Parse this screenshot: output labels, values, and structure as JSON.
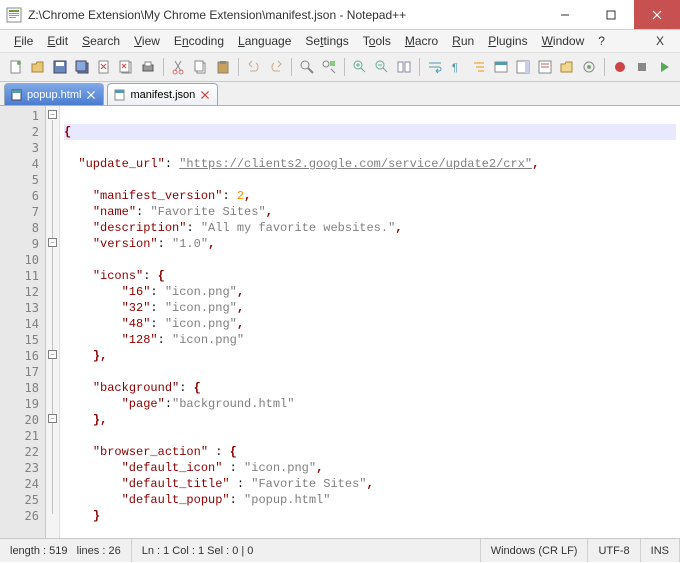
{
  "window": {
    "title": "Z:\\Chrome Extension\\My Chrome Extension\\manifest.json - Notepad++"
  },
  "menus": {
    "file": "File",
    "edit": "Edit",
    "search": "Search",
    "view": "View",
    "encoding": "Encoding",
    "language": "Language",
    "settings": "Settings",
    "tools": "Tools",
    "macro": "Macro",
    "run": "Run",
    "plugins": "Plugins",
    "window": "Window",
    "help": "?",
    "x": "X"
  },
  "tabs": {
    "t0": "popup.html",
    "t1": "manifest.json"
  },
  "lines": {
    "l1": "1",
    "l2": "2",
    "l3": "3",
    "l4": "4",
    "l5": "5",
    "l6": "6",
    "l7": "7",
    "l8": "8",
    "l9": "9",
    "l10": "10",
    "l11": "11",
    "l12": "12",
    "l13": "13",
    "l14": "14",
    "l15": "15",
    "l16": "16",
    "l17": "17",
    "l18": "18",
    "l19": "19",
    "l20": "20",
    "l21": "21",
    "l22": "22",
    "l23": "23",
    "l24": "24",
    "l25": "25",
    "l26": "26"
  },
  "code": {
    "open_brace": "{",
    "close_brace": "}",
    "comma": ",",
    "update_url_key": "\"update_url\"",
    "update_url_val": "\"https://clients2.google.com/service/update2/crx\"",
    "mv_key": "\"manifest_version\"",
    "mv_val": "2",
    "name_key": "\"name\"",
    "name_val": "\"Favorite Sites\"",
    "desc_key": "\"description\"",
    "desc_val": "\"All my favorite websites.\"",
    "ver_key": "\"version\"",
    "ver_val": "\"1.0\"",
    "icons_key": "\"icons\"",
    "ic16_key": "\"16\"",
    "ic16_val": "\"icon.png\"",
    "ic32_key": "\"32\"",
    "ic32_val": "\"icon.png\"",
    "ic48_key": "\"48\"",
    "ic48_val": "\"icon.png\"",
    "ic128_key": "\"128\"",
    "ic128_val": "\"icon.png\"",
    "bg_key": "\"background\"",
    "page_key": "\"page\"",
    "page_val": "\"background.html\"",
    "ba_key": "\"browser_action\"",
    "di_key": "\"default_icon\"",
    "di_val": "\"icon.png\"",
    "dt_key": "\"default_title\"",
    "dt_val": "\"Favorite Sites\"",
    "dp_key": "\"default_popup\"",
    "dp_val": "\"popup.html\""
  },
  "status": {
    "length": "length : 519",
    "lines": "lines : 26",
    "pos": "Ln : 1    Col : 1    Sel : 0 | 0",
    "eol": "Windows (CR LF)",
    "enc": "UTF-8",
    "mode": "INS"
  }
}
